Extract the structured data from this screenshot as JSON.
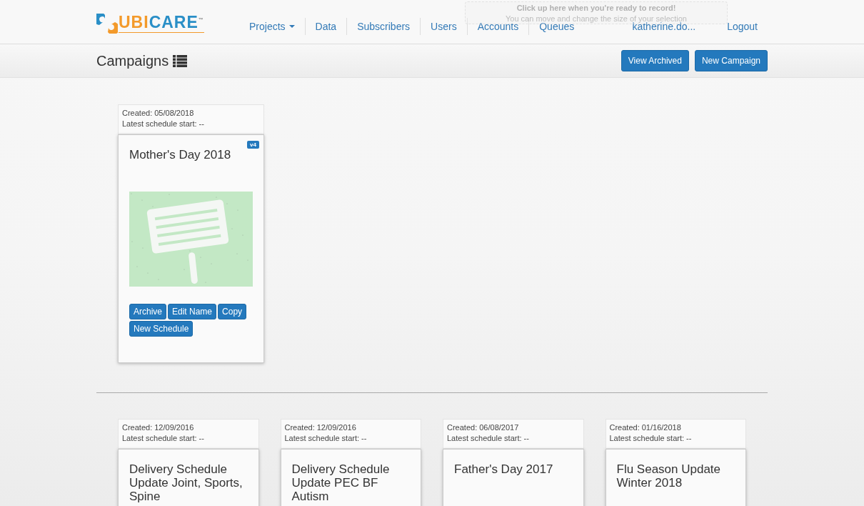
{
  "logo": {
    "first": "UBI",
    "second": "CARE",
    "mark": "™"
  },
  "nav": [
    {
      "label": "Projects",
      "dropdown": true
    },
    {
      "label": "Data",
      "dropdown": false
    },
    {
      "label": "Subscribers",
      "dropdown": false
    },
    {
      "label": "Users",
      "dropdown": false
    },
    {
      "label": "Accounts",
      "dropdown": false
    },
    {
      "label": "Queues",
      "dropdown": false
    }
  ],
  "user": "katherine.do...",
  "logout": "Logout",
  "recorder_hint": {
    "title": "Click up here when you're ready to record!",
    "subtitle": "You can move and change the size of your selection"
  },
  "page_title": "Campaigns",
  "actions": [
    "View Archived",
    "New Campaign"
  ],
  "featured": [
    {
      "created": "Created: 05/08/2018",
      "latest": "Latest schedule start: --",
      "title": "Mother's Day 2018",
      "badge": "v4",
      "buttons": [
        "Archive",
        "Edit Name",
        "Copy",
        "New Schedule"
      ]
    }
  ],
  "campaigns": [
    {
      "created": "Created: 12/09/2016",
      "latest": "Latest schedule start: --",
      "title": "Delivery Schedule Update Joint, Sports, Spine"
    },
    {
      "created": "Created: 12/09/2016",
      "latest": "Latest schedule start: --",
      "title": "Delivery Schedule Update PEC BF Autism"
    },
    {
      "created": "Created: 06/08/2017",
      "latest": "Latest schedule start: --",
      "title": "Father's Day 2017"
    },
    {
      "created": "Created: 01/16/2018",
      "latest": "Latest schedule start: --",
      "title": "Flu Season Update Winter 2018"
    }
  ]
}
